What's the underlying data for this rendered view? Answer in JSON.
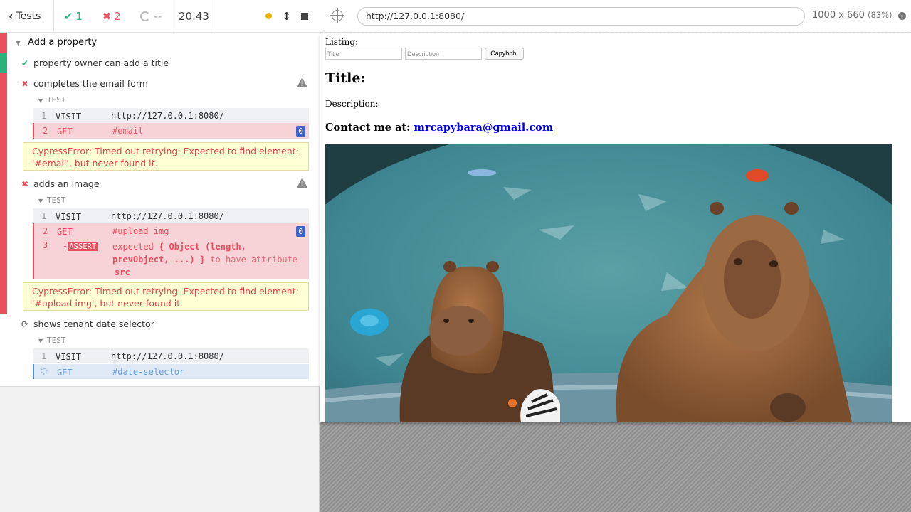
{
  "reporter": {
    "tests_label": "Tests",
    "passed": "1",
    "failed": "2",
    "pending": "--",
    "duration": "20.43",
    "suite_title": "Add a property",
    "tests": [
      {
        "title": "property owner can add a title",
        "state": "passed"
      },
      {
        "title": "completes the email form",
        "state": "failed",
        "section": "TEST",
        "commands": [
          {
            "num": "1",
            "name": "VISIT",
            "message": "http://127.0.0.1:8080/"
          },
          {
            "num": "2",
            "name": "GET",
            "message": "#email",
            "badge": "0"
          }
        ],
        "error_line1": "CypressError: Timed out retrying: Expected to find element:",
        "error_line2": "'#email', but never found it."
      },
      {
        "title": "adds an image",
        "state": "failed",
        "section": "TEST",
        "commands": [
          {
            "num": "1",
            "name": "VISIT",
            "message": "http://127.0.0.1:8080/"
          },
          {
            "num": "2",
            "name": "GET",
            "message": "#upload img",
            "badge": "0"
          },
          {
            "num": "3",
            "name": "-ASSERT",
            "prefix": "-",
            "tag": "ASSERT",
            "msg_a": "expected",
            "msg_b": "{ Object (length,",
            "msg_c": "prevObject, ...) }",
            "msg_d": "to have attribute",
            "msg_e": "src"
          }
        ],
        "error_line1": "CypressError: Timed out retrying: Expected to find element:",
        "error_line2": "'#upload img', but never found it."
      },
      {
        "title": "shows tenant date selector",
        "state": "running",
        "section": "TEST",
        "commands": [
          {
            "num": "1",
            "name": "VISIT",
            "message": "http://127.0.0.1:8080/"
          },
          {
            "num": "",
            "name": "GET",
            "message": "#date-selector"
          }
        ]
      }
    ]
  },
  "aut": {
    "url": "http://127.0.0.1:8080/",
    "viewport": "1000 x 660",
    "scale": "(83%)",
    "info_icon": "i",
    "app": {
      "listing_label": "Listing:",
      "title_placeholder": "Title",
      "description_placeholder": "Description",
      "submit_label": "Capybnb!",
      "title_heading": "Title:",
      "description_label": "Description:",
      "contact_label": "Contact me at:",
      "contact_email": "mrcapybara@gmail.com"
    }
  },
  "colors": {
    "pass": "#2ab27b",
    "fail": "#e94f5f",
    "pending_blue": "#4c8fd6",
    "error_bg": "#ffffd4",
    "badge": "#3f63c6"
  }
}
